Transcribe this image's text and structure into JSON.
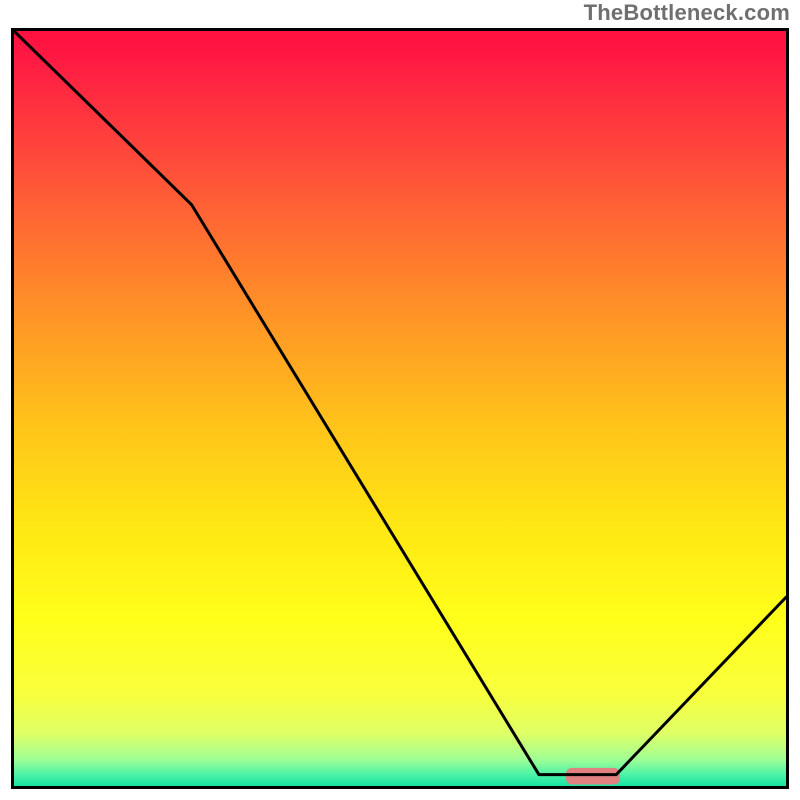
{
  "watermark": "TheBottleneck.com",
  "chart_data": {
    "type": "line",
    "title": "",
    "xlabel": "",
    "ylabel": "",
    "xlim": [
      0,
      100
    ],
    "ylim": [
      0,
      100
    ],
    "grid": false,
    "series": [
      {
        "name": "curve",
        "x": [
          0,
          23,
          68,
          72,
          78,
          100
        ],
        "y": [
          100,
          77,
          1.5,
          1.5,
          1.5,
          25
        ]
      }
    ],
    "marker": {
      "name": "highlight-segment",
      "x_range": [
        71.5,
        78.5
      ],
      "y": 1.3,
      "thickness": 2.2,
      "color": "#E08080"
    },
    "background_gradient": {
      "stops": [
        {
          "offset": 0.0,
          "color": "#FF1040"
        },
        {
          "offset": 0.04,
          "color": "#FF1B43"
        },
        {
          "offset": 0.18,
          "color": "#FF4E3A"
        },
        {
          "offset": 0.36,
          "color": "#FF8E28"
        },
        {
          "offset": 0.52,
          "color": "#FFC31A"
        },
        {
          "offset": 0.66,
          "color": "#FFE813"
        },
        {
          "offset": 0.78,
          "color": "#FFFF1A"
        },
        {
          "offset": 0.88,
          "color": "#F8FF3E"
        },
        {
          "offset": 0.93,
          "color": "#DFFF66"
        },
        {
          "offset": 0.965,
          "color": "#9FFF95"
        },
        {
          "offset": 0.985,
          "color": "#4BF3A7"
        },
        {
          "offset": 1.0,
          "color": "#17E3A3"
        }
      ]
    },
    "line_color": "#000000",
    "line_width": 3
  }
}
